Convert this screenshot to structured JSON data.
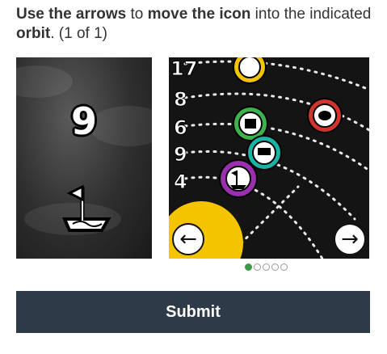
{
  "instruction": {
    "part1": "Use the arrows",
    "part2": " to ",
    "part3": "move the icon",
    "part4": " into the indicated ",
    "part5": "orbit",
    "part6": ". (1 of 1)"
  },
  "left_panel": {
    "target_number": "9",
    "icon": "flag-on-map-icon"
  },
  "right_panel": {
    "orbit_numbers": [
      "17",
      "8",
      "6",
      "9",
      "4"
    ],
    "icons": [
      "bag-icon",
      "building-icon",
      "brain-icon",
      "cart-icon",
      "flag-on-map-icon"
    ]
  },
  "navigation": {
    "prev_label": "←",
    "next_label": "→"
  },
  "pager": {
    "total": 5,
    "current": 1
  },
  "submit_label": "Submit",
  "colors": {
    "accent_green": "#3e9a4a",
    "submit_bg": "#2e3a47",
    "orbit_yellow": "#f4c400",
    "ring_green": "#3cb44b",
    "ring_teal": "#1ab3a6",
    "ring_purple": "#9b2fb0",
    "ring_red": "#d0342c"
  }
}
